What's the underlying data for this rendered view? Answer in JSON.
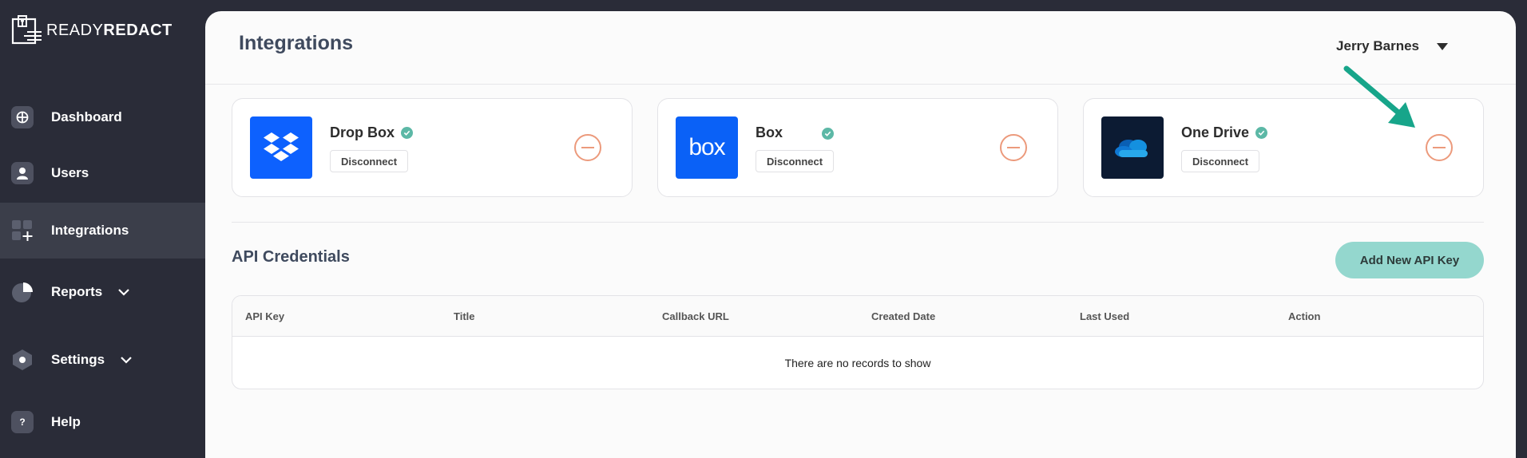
{
  "brand": {
    "name_light": "READY",
    "name_bold": "REDACT"
  },
  "sidebar": {
    "items": [
      {
        "label": "Dashboard",
        "icon": "dashboard-icon"
      },
      {
        "label": "Users",
        "icon": "user-icon"
      },
      {
        "label": "Integrations",
        "icon": "integrations-icon",
        "active": true
      },
      {
        "label": "Reports",
        "icon": "pie-chart-icon",
        "expandable": true
      },
      {
        "label": "Settings",
        "icon": "hexagon-icon",
        "expandable": true
      },
      {
        "label": "Help",
        "icon": "help-icon"
      }
    ]
  },
  "header": {
    "title": "Integrations",
    "user_name": "Jerry Barnes"
  },
  "integrations": [
    {
      "name": "Drop Box",
      "action_label": "Disconnect",
      "logo": "dropbox-logo",
      "logo_bg": "#0d61fe",
      "connected": true
    },
    {
      "name": "Box",
      "action_label": "Disconnect",
      "logo": "box-logo",
      "logo_text": "box",
      "logo_bg": "#0a61f7",
      "connected": true
    },
    {
      "name": "One Drive",
      "action_label": "Disconnect",
      "logo": "onedrive-logo",
      "logo_bg": "#0c1b33",
      "connected": true
    }
  ],
  "api_credentials": {
    "title": "API Credentials",
    "add_button_label": "Add New API Key",
    "columns": [
      "API Key",
      "Title",
      "Callback URL",
      "Created Date",
      "Last Used",
      "Action"
    ],
    "rows": [],
    "empty_message": "There are no records to show"
  },
  "colors": {
    "sidebar_bg": "#2a2c38",
    "active_item_bg": "#3b3e4a",
    "accent_teal": "#94d7ce",
    "verified_check": "#5cb8a6",
    "remove_icon": "#ec9a7c",
    "annotation_arrow": "#17a58a"
  }
}
